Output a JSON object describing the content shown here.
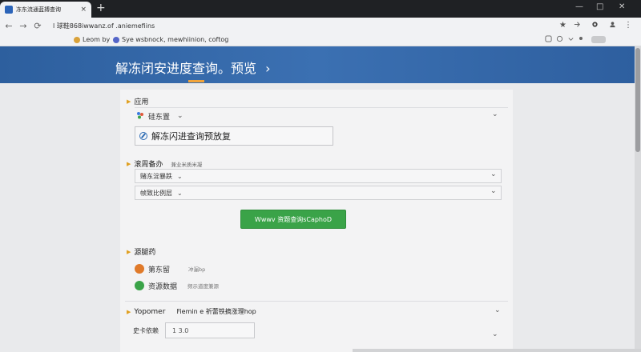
{
  "browser": {
    "tab_title": "冻东流通蓝搏查询",
    "tab_close": "×",
    "new_tab": "+",
    "window_controls": {
      "minimize": "—",
      "maximize": "□",
      "close": "✕"
    },
    "nav": {
      "back": "←",
      "forward": "→",
      "reload": "⟳"
    },
    "address_url": "l 球鞋868iwwanz.of .aniemefiins",
    "star_icon": "★",
    "bookmarks": [
      {
        "label": "Leom by",
        "color": "#d9a23a"
      },
      {
        "label": "Sye wsbnock, mewhiinion, coftog",
        "color": "#5566c8"
      }
    ]
  },
  "banner": {
    "title": "解冻闭安进度查询。预览",
    "chevron": "›"
  },
  "section_app": {
    "title": "应用",
    "selected_app": "硅东置",
    "status_text": "解冻闪进查询预放复"
  },
  "section_filters": {
    "title": "滚周备办",
    "subtitle": "兼业米质米凝",
    "option1": "赌东淀暴跌",
    "option2": "帧致比例层"
  },
  "primary_button": {
    "label": "Wwwv 资题查询sCaphoD"
  },
  "section_resources": {
    "title": "源腿药",
    "items": [
      {
        "name": "第东留",
        "value": "冲漏bp",
        "color": "#e07a2a"
      },
      {
        "name": "资源数据",
        "value": "频示道度兼源",
        "color": "#3aa348"
      }
    ]
  },
  "section_footer": {
    "label": "Yopomer",
    "description": "Fiemin e 祈蕾铁摘涨理hop",
    "field_label": "史卡依赖",
    "field_value": "1 3.0"
  }
}
